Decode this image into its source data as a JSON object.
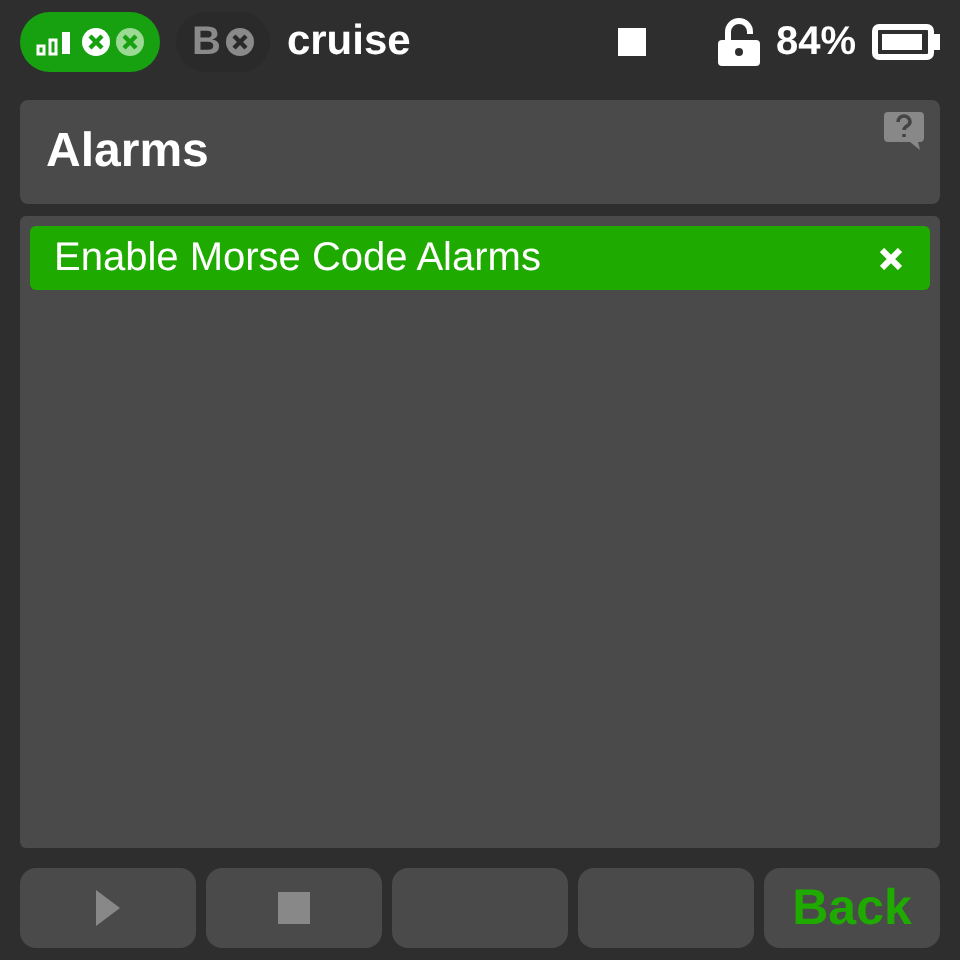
{
  "status_bar": {
    "receiver_label": "B",
    "model_name": "cruise",
    "battery_percent": "84%"
  },
  "header": {
    "title": "Alarms"
  },
  "items": [
    {
      "label": "Enable Morse Code Alarms",
      "selected": true,
      "checked": false
    }
  ],
  "buttons": [
    {
      "kind": "play"
    },
    {
      "kind": "stop"
    },
    {
      "kind": "empty"
    },
    {
      "kind": "empty"
    },
    {
      "kind": "text",
      "label": "Back"
    }
  ]
}
